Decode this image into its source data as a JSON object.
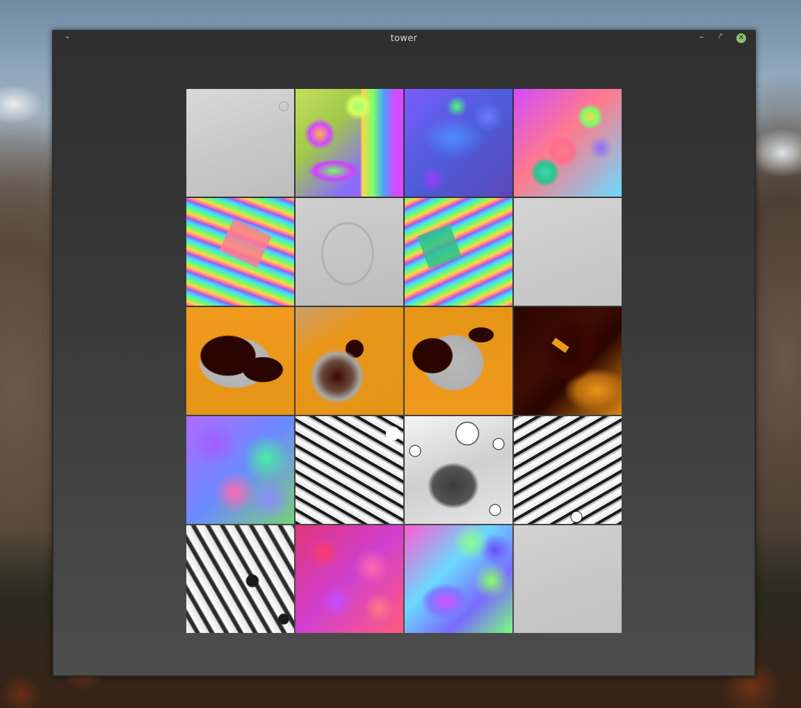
{
  "window": {
    "title": "tower",
    "menu_icon": "chevron-down-icon",
    "minimize_icon": "minimize-icon",
    "maximize_icon": "maximize-icon",
    "close_icon": "close-icon",
    "close_color": "#8fbf6e"
  },
  "grid": {
    "rows": 5,
    "columns": 4,
    "tiles": [
      {
        "kind": "height-map-gray"
      },
      {
        "kind": "normal-map-rainbow"
      },
      {
        "kind": "color-patches-blue-purple"
      },
      {
        "kind": "normal-map-colorful"
      },
      {
        "kind": "normal-map-stripes"
      },
      {
        "kind": "height-map-gray"
      },
      {
        "kind": "normal-map-stripes"
      },
      {
        "kind": "height-map-gray"
      },
      {
        "kind": "orange-dark-mask"
      },
      {
        "kind": "orange-dark-mask"
      },
      {
        "kind": "orange-dark-mask"
      },
      {
        "kind": "orange-dark-gradient"
      },
      {
        "kind": "color-patches-pastel"
      },
      {
        "kind": "grayscale-occlusion"
      },
      {
        "kind": "grayscale-occlusion"
      },
      {
        "kind": "grayscale-occlusion"
      },
      {
        "kind": "grayscale-occlusion"
      },
      {
        "kind": "color-patches-pink-red"
      },
      {
        "kind": "color-patches-green-purple"
      },
      {
        "kind": "height-map-gray"
      }
    ]
  }
}
